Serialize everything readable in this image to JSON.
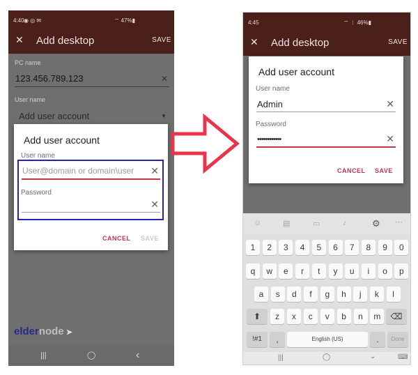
{
  "left": {
    "status": {
      "time": "4:40",
      "icons": "◉ ◎ ✉",
      "battery": "⌔ 47%▮"
    },
    "appbar": {
      "close_icon": "✕",
      "title": "Add desktop",
      "save": "SAVE"
    },
    "background": {
      "pc_name_label": "PC name",
      "pc_name_value": "123.456.789.123",
      "user_name_label": "User name",
      "user_account_value": "Add user account"
    },
    "dialog": {
      "title": "Add user account",
      "username_label": "User name",
      "username_placeholder": "User@domain or domain\\user",
      "password_label": "Password",
      "cancel": "CANCEL",
      "save": "SAVE"
    },
    "watermark": "eldernode",
    "nav": {
      "recents": "|||",
      "home": "◯",
      "back": "‹"
    }
  },
  "right": {
    "status": {
      "time": "4:45",
      "battery": "⌔ ⋮ 46%▮"
    },
    "appbar": {
      "close_icon": "✕",
      "title": "Add desktop",
      "save": "SAVE"
    },
    "dialog": {
      "title": "Add user account",
      "username_label": "User name",
      "username_value": "Admin",
      "password_label": "Password",
      "password_value": "••••••••••••",
      "cancel": "CANCEL",
      "save": "SAVE"
    },
    "keyboard": {
      "row_numbers": [
        "1",
        "2",
        "3",
        "4",
        "5",
        "6",
        "7",
        "8",
        "9",
        "0"
      ],
      "row_top": [
        "q",
        "w",
        "e",
        "r",
        "t",
        "y",
        "u",
        "i",
        "o",
        "p"
      ],
      "row_mid": [
        "a",
        "s",
        "d",
        "f",
        "g",
        "h",
        "j",
        "k",
        "l"
      ],
      "row_bottom": [
        "z",
        "x",
        "c",
        "v",
        "b",
        "n",
        "m"
      ],
      "shift": "⬆",
      "backspace": "⌫",
      "symbols": "!#1",
      "comma": ",",
      "space_label": "English (US)",
      "period": ".",
      "done": "Done"
    },
    "nav": {
      "recents": "|||",
      "home": "◯",
      "back": "⌄",
      "keyboard": "⌨"
    }
  },
  "colors": {
    "appbar": "#4b1f1a",
    "accent": "#c0354c",
    "highlight_box": "#2323b8",
    "arrow": "#e8354c"
  }
}
